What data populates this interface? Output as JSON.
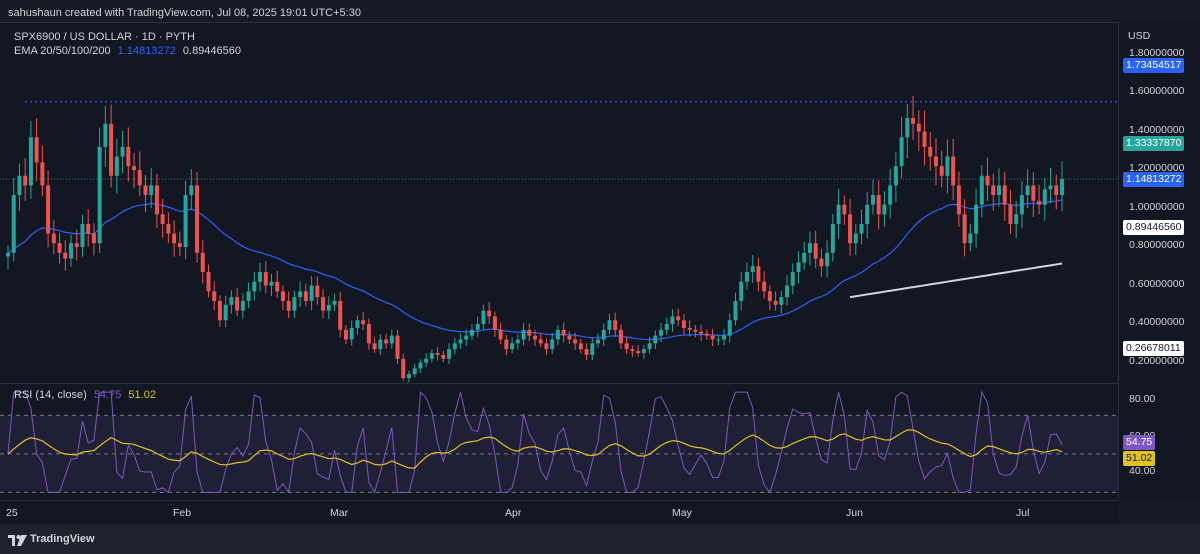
{
  "credit": "sahushaun created with TradingView.com, Jul 08, 2025 19:01 UTC+5:30",
  "legend": {
    "symbol": "SPX6900 / US DOLLAR · 1D · PYTH",
    "ema_label": "EMA 20/50/100/200",
    "ema_value_1": "1.14813272",
    "ema_value_2": "0.89446560"
  },
  "currency": "USD",
  "price_axis_labels": [
    "1.80000000",
    "1.60000000",
    "1.40000000",
    "1.20000000",
    "1.00000000",
    "0.80000000",
    "0.60000000",
    "0.40000000",
    "0.20000000"
  ],
  "price_tags": {
    "high_line": "1.73454517",
    "last_price": "1.33337870",
    "ema_blue": "1.14813272",
    "ema_white": "0.89446560",
    "low_line": "0.26678011"
  },
  "rsi": {
    "label": "RSI (14, close)",
    "value": "54.75",
    "ma_value": "51.02",
    "axis_labels": [
      "80.00",
      "60.00",
      "40.00"
    ]
  },
  "time_labels": [
    "25",
    "Feb",
    "Mar",
    "Apr",
    "May",
    "Jun",
    "Jul"
  ],
  "brand": "TradingView",
  "colors": {
    "up": "#26a69a",
    "down": "#ef5350",
    "ema_blue": "#2962ff",
    "ema_white": "#d1d4dc",
    "rsi_line": "#7e57c2",
    "rsi_ma": "#e0c31c",
    "last_price_bg": "#26a69a"
  },
  "chart_data": {
    "type": "candlestick",
    "y_axis_range": [
      0.2,
      1.8
    ],
    "high_line": 1.73454517,
    "low_line": 0.26678011,
    "last_price": 1.3333787,
    "ema_50": 1.14813272,
    "ema_200": 0.8944656,
    "rsi_range": [
      30,
      85
    ],
    "rsi_levels": [
      70,
      50,
      30
    ],
    "rsi_value": 54.75,
    "rsi_ma_value": 51.02
  }
}
